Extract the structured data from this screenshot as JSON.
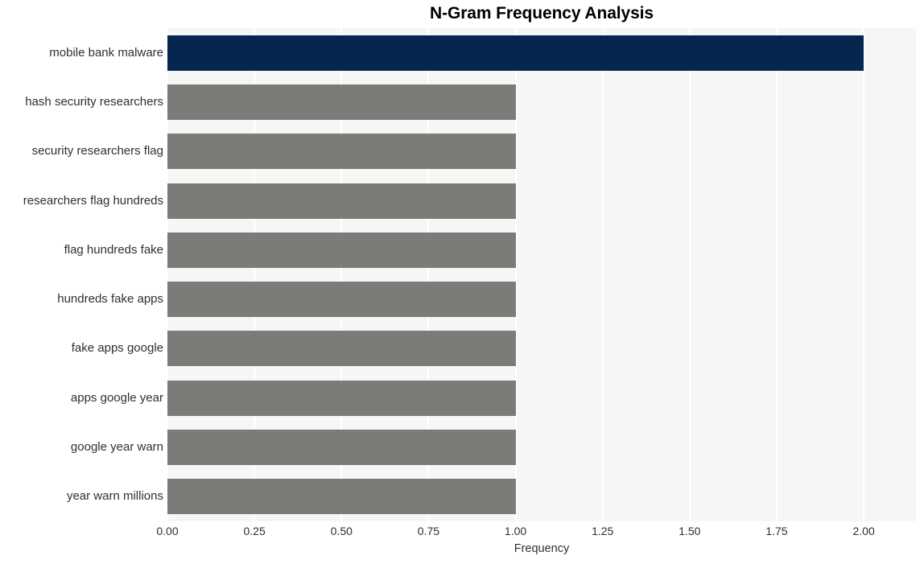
{
  "chart_data": {
    "type": "bar",
    "orientation": "horizontal",
    "title": "N-Gram Frequency Analysis",
    "xlabel": "Frequency",
    "ylabel": "",
    "xlim": [
      0.0,
      2.15
    ],
    "xticks": [
      "0.00",
      "0.25",
      "0.50",
      "0.75",
      "1.00",
      "1.25",
      "1.50",
      "1.75",
      "2.00"
    ],
    "xtick_values": [
      0.0,
      0.25,
      0.5,
      0.75,
      1.0,
      1.25,
      1.5,
      1.75,
      2.0
    ],
    "grid": "vertical-white",
    "legend": "none",
    "categories": [
      "mobile bank malware",
      "hash security researchers",
      "security researchers flag",
      "researchers flag hundreds",
      "flag hundreds fake",
      "hundreds fake apps",
      "fake apps google",
      "apps google year",
      "google year warn",
      "year warn millions"
    ],
    "values": [
      2,
      1,
      1,
      1,
      1,
      1,
      1,
      1,
      1,
      1
    ],
    "bar_colors": [
      "#04264f",
      "#7b7b78",
      "#7b7b78",
      "#7b7b78",
      "#7b7b78",
      "#7b7b78",
      "#7b7b78",
      "#7b7b78",
      "#7b7b78",
      "#7b7b78"
    ]
  },
  "colors": {
    "highlight_bar": "#04264f",
    "default_bar": "#7b7b78",
    "plot_background": "#f6f6f6",
    "gridline": "#ffffff",
    "figure_background": "#ffffff",
    "text": "#2f2f2f",
    "title_text": "#000000"
  }
}
